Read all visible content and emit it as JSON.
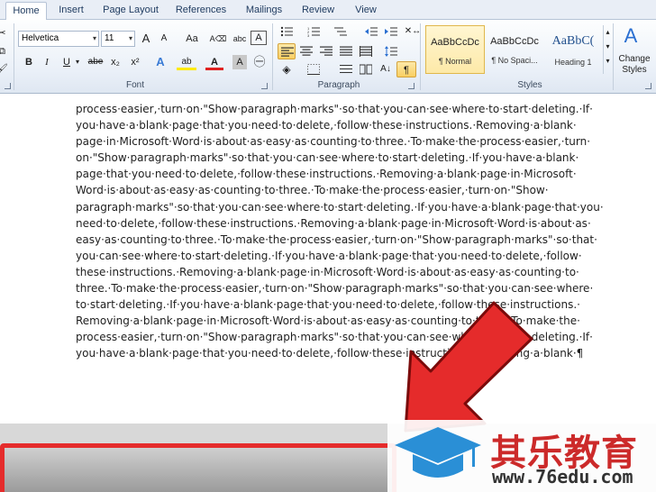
{
  "tabs": [
    "Home",
    "Insert",
    "Page Layout",
    "References",
    "Mailings",
    "Review",
    "View"
  ],
  "font": {
    "name": "Helvetica",
    "size": "11",
    "buttons": {
      "grow": "A",
      "shrink": "A",
      "change_case": "Aa",
      "bold": "B",
      "italic": "I",
      "underline": "U",
      "strikethrough": "abe",
      "subscript": "x₂",
      "superscript": "x²",
      "text_effect": "A",
      "highlight": "ab",
      "font_color": "A",
      "char_shading": "A"
    },
    "group_label": "Font"
  },
  "paragraph": {
    "group_label": "Paragraph",
    "show_marks": "¶"
  },
  "styles": {
    "items": [
      {
        "sample": "AaBbCcDc",
        "name": "¶ Normal"
      },
      {
        "sample": "AaBbCcDc",
        "name": "¶ No Spaci..."
      },
      {
        "sample": "AaBbC(",
        "name": "Heading 1"
      }
    ],
    "change_styles": "Change Styles",
    "group_label": "Styles"
  },
  "document": {
    "lines": [
      "process·easier,·turn·on·\"Show·paragraph·marks\"·so·that·you·can·see·where·to·start·deleting.·If·",
      "you·have·a·blank·page·that·you·need·to·delete,·follow·these·instructions.·Removing·a·blank·",
      "page·in·Microsoft·Word·is·about·as·easy·as·counting·to·three.·To·make·the·process·easier,·turn·",
      "on·\"Show·paragraph·marks\"·so·that·you·can·see·where·to·start·deleting.·If·you·have·a·blank·",
      "page·that·you·need·to·delete,·follow·these·instructions.·Removing·a·blank·page·in·Microsoft·",
      "Word·is·about·as·easy·as·counting·to·three.·To·make·the·process·easier,·turn·on·\"Show·",
      "paragraph·marks\"·so·that·you·can·see·where·to·start·deleting.·If·you·have·a·blank·page·that·you·",
      "need·to·delete,·follow·these·instructions.·Removing·a·blank·page·in·Microsoft·Word·is·about·as·",
      "easy·as·counting·to·three.·To·make·the·process·easier,·turn·on·\"Show·paragraph·marks\"·so·that·",
      "you·can·see·where·to·start·deleting.·If·you·have·a·blank·page·that·you·need·to·delete,·follow·",
      "these·instructions.·Removing·a·blank·page·in·Microsoft·Word·is·about·as·easy·as·counting·to·",
      "three.·To·make·the·process·easier,·turn·on·\"Show·paragraph·marks\"·so·that·you·can·see·where·",
      "to·start·deleting.·If·you·have·a·blank·page·that·you·need·to·delete,·follow·these·instructions.·",
      "Removing·a·blank·page·in·Microsoft·Word·is·about·as·easy·as·counting·to·three.·To·make·the·",
      "process·easier,·turn·on·\"Show·paragraph·marks\"·so·that·you·can·see·where·to·start·deleting.·If·",
      "you·have·a·blank·page·that·you·need·to·delete,·follow·these·instructions.·Removing·a·blank·¶"
    ]
  },
  "watermark": {
    "brand_cn": "其乐教育",
    "url": "www.76edu.com"
  },
  "colors": {
    "arrow": "#e52b2b",
    "highlight_button": "#f9cf62",
    "watermark_cap": "#2a8fd6"
  }
}
